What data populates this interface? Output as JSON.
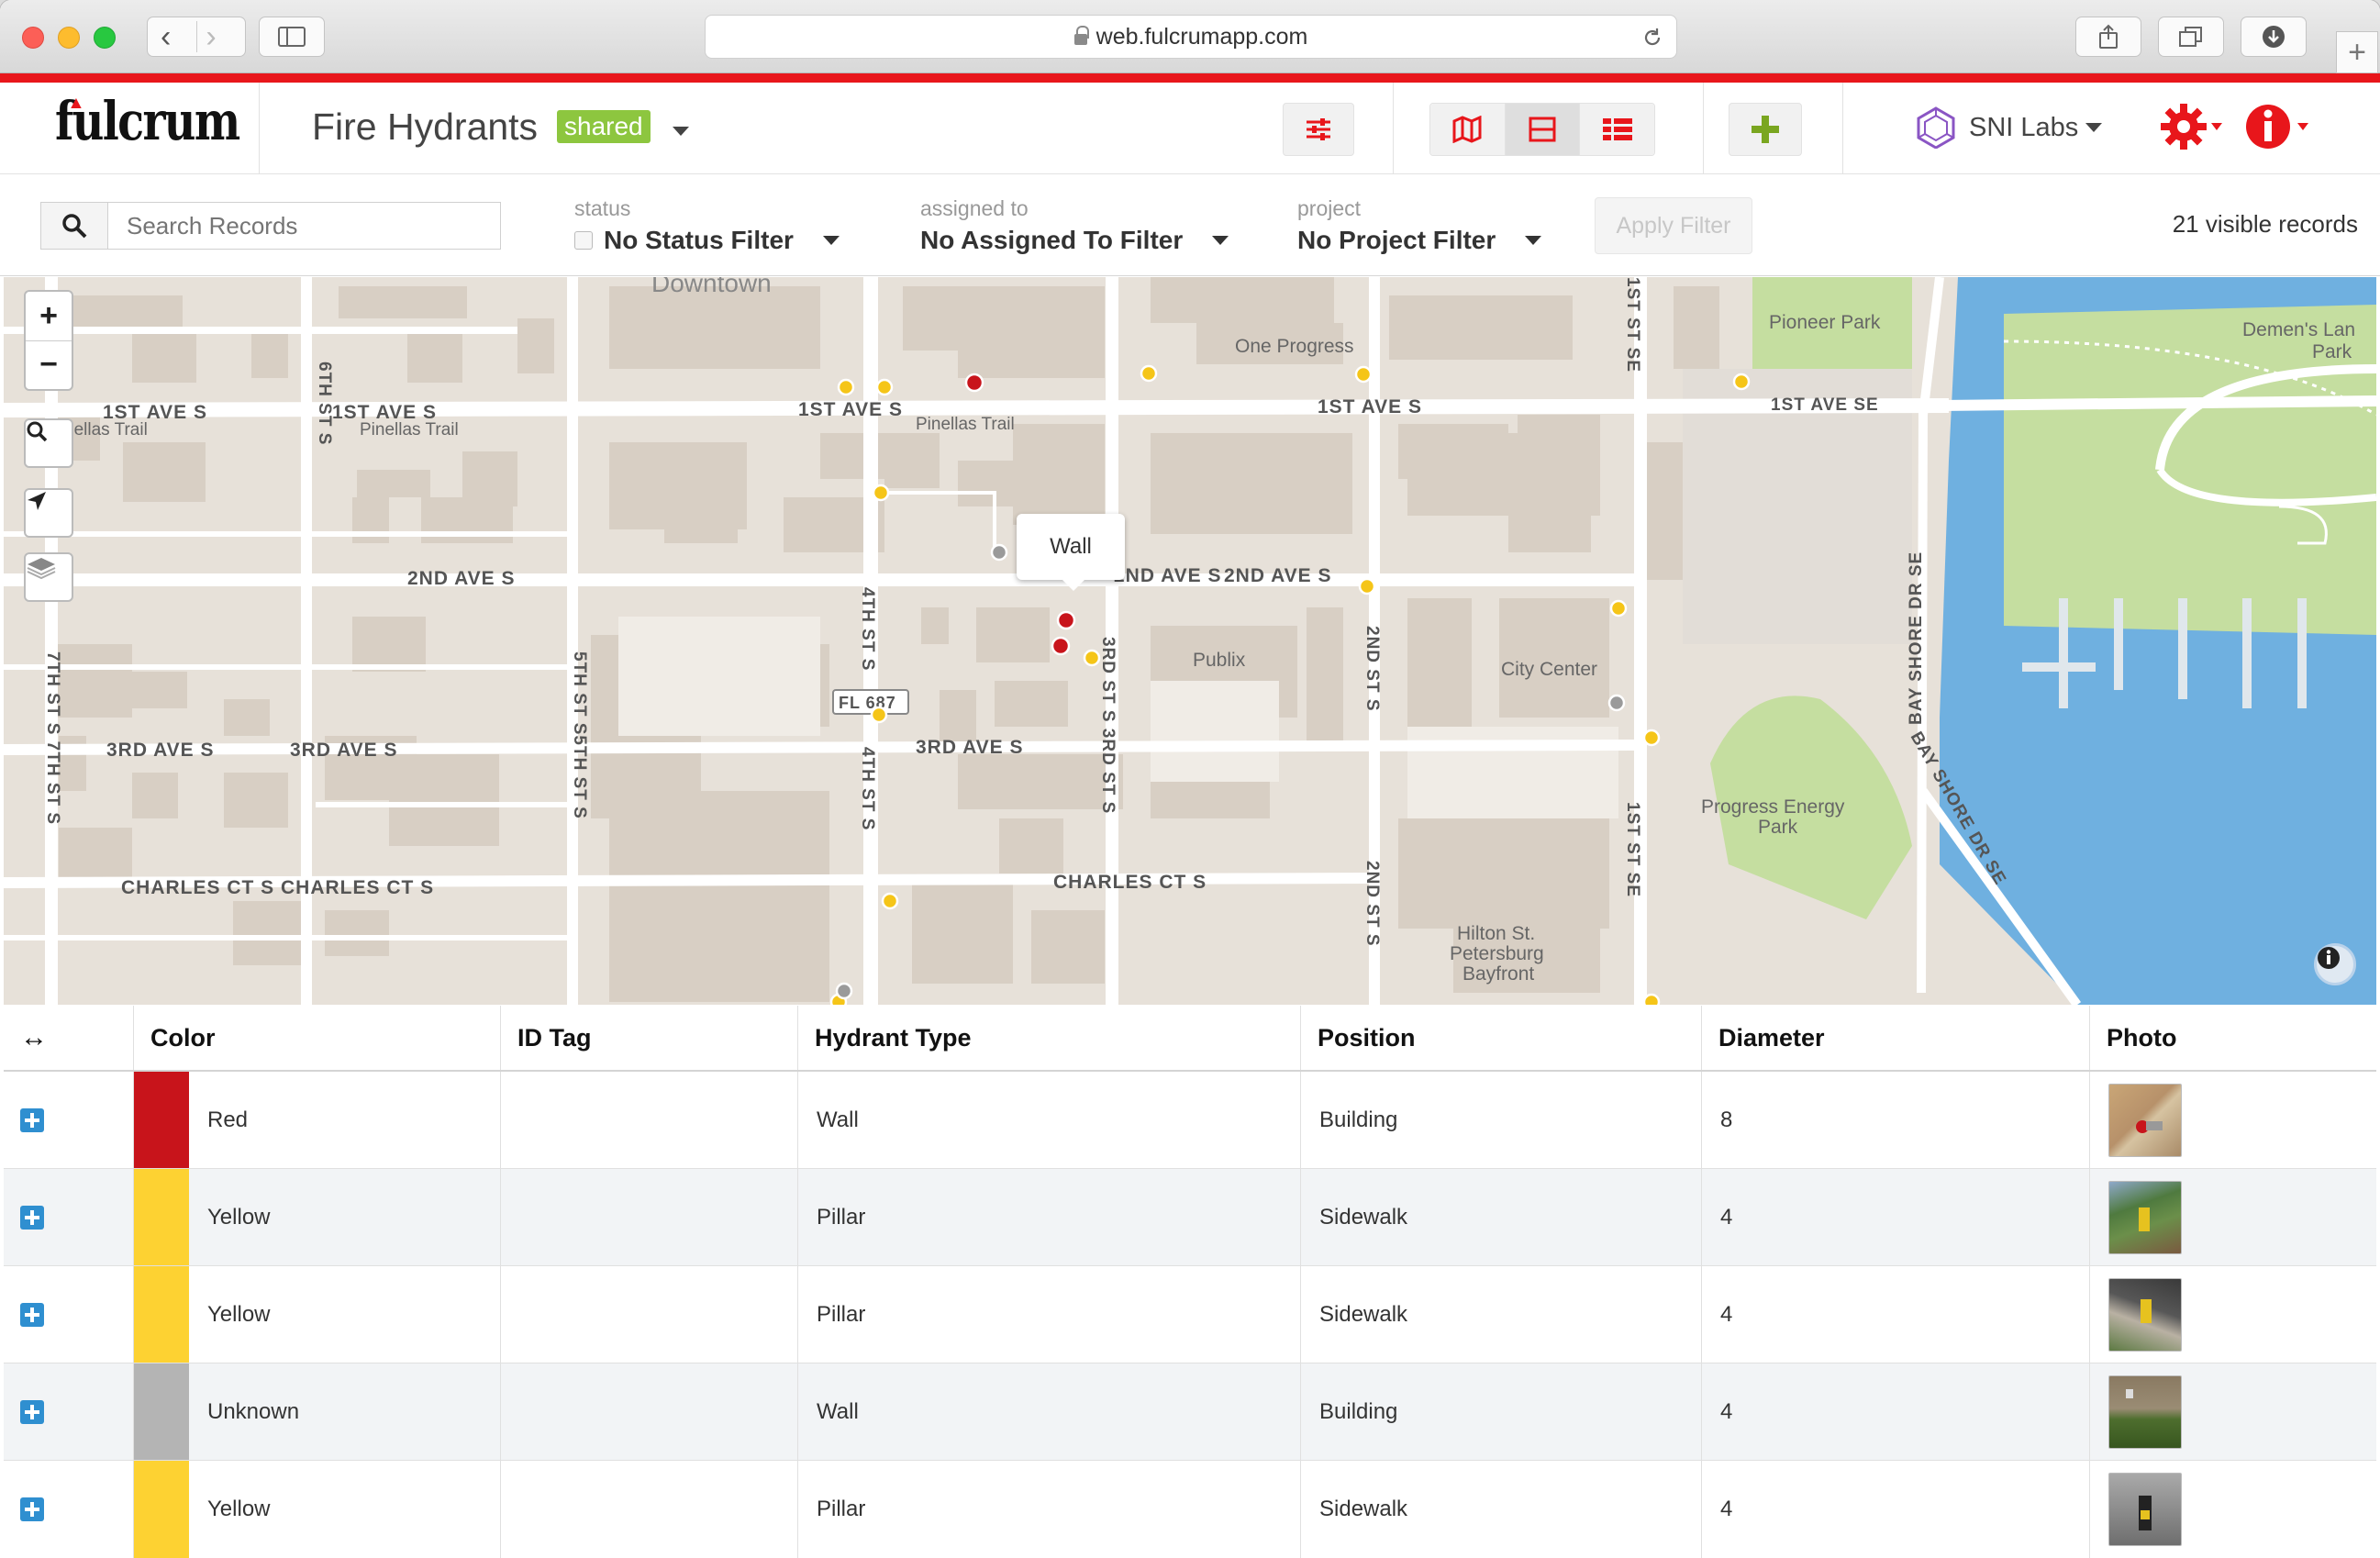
{
  "browser": {
    "url": "web.fulcrumapp.com"
  },
  "header": {
    "logo": "fulcrum",
    "app_title": "Fire Hydrants",
    "shared_badge": "shared",
    "org_name": "SNI Labs"
  },
  "filters": {
    "search_placeholder": "Search Records",
    "status_label": "status",
    "status_value": "No Status Filter",
    "assigned_label": "assigned to",
    "assigned_value": "No Assigned To Filter",
    "project_label": "project",
    "project_value": "No Project Filter",
    "apply_label": "Apply Filter",
    "record_count": "21 visible records"
  },
  "map": {
    "popup_text": "Wall",
    "zoom_in": "+",
    "zoom_out": "−",
    "labels": {
      "downtown": "Downtown",
      "ave1_a": "1ST AVE S",
      "ave1_b": "1ST AVE S",
      "ave1_c": "1ST AVE S",
      "ave1_d": "1ST AVE S",
      "ave1_se": "1ST AVE SE",
      "pinellas_a": "nellas Trail",
      "pinellas_b": "Pinellas Trail",
      "pinellas_c": "Pinellas Trail",
      "ave2_a": "2ND AVE S",
      "ave2_b": "2ND AVE S",
      "ave2_c": "2ND AVE S",
      "ave3_a": "3RD AVE S",
      "ave3_b": "3RD AVE S",
      "ave3_c": "3RD AVE S",
      "charles_a": "CHARLES CT S",
      "charles_b": "CHARLES CT S",
      "charles_c": "CHARLES CT S",
      "st6": "6TH ST S",
      "st7": "7TH ST S 7TH ST S",
      "st5": "5TH ST S5TH ST S",
      "st4_a": "4TH ST S",
      "st4_b": "4TH ST S",
      "st3": "3RD ST S 3RD ST S",
      "st2_a": "2ND ST S",
      "st2_b": "2ND ST S",
      "st1_a": "1ST ST SE",
      "st1_b": "1ST ST SE",
      "bayshore_a": "BAY SHORE DR SE",
      "bayshore_b": "BAY SHORE DR SE",
      "fl687": "FL 687",
      "one_progress": "One Progress",
      "publix": "Publix",
      "city_center": "City Center",
      "pioneer_park": "Pioneer Park",
      "demens_1": "Demen's Lan",
      "demens_2": "Park",
      "progress_1": "Progress Energy",
      "progress_2": "Park",
      "hilton_1": "Hilton St.",
      "hilton_2": "Petersburg",
      "hilton_3": "Bayfront"
    }
  },
  "table": {
    "columns": [
      "Color",
      "ID Tag",
      "Hydrant Type",
      "Position",
      "Diameter",
      "Photo"
    ],
    "rows": [
      {
        "color": "Red",
        "swatch": "#c8141b",
        "id_tag": "",
        "type": "Wall",
        "position": "Building",
        "diameter": "8"
      },
      {
        "color": "Yellow",
        "swatch": "#fdd232",
        "id_tag": "",
        "type": "Pillar",
        "position": "Sidewalk",
        "diameter": "4"
      },
      {
        "color": "Yellow",
        "swatch": "#fdd232",
        "id_tag": "",
        "type": "Pillar",
        "position": "Sidewalk",
        "diameter": "4"
      },
      {
        "color": "Unknown",
        "swatch": "#b4b4b4",
        "id_tag": "",
        "type": "Wall",
        "position": "Building",
        "diameter": "4"
      },
      {
        "color": "Yellow",
        "swatch": "#fdd232",
        "id_tag": "",
        "type": "Pillar",
        "position": "Sidewalk",
        "diameter": "4"
      }
    ]
  },
  "colors": {
    "brand_red": "#e8161b",
    "shared_green": "#8dc63f",
    "map_water": "#6fb0e0",
    "map_park": "#c5dea0"
  }
}
